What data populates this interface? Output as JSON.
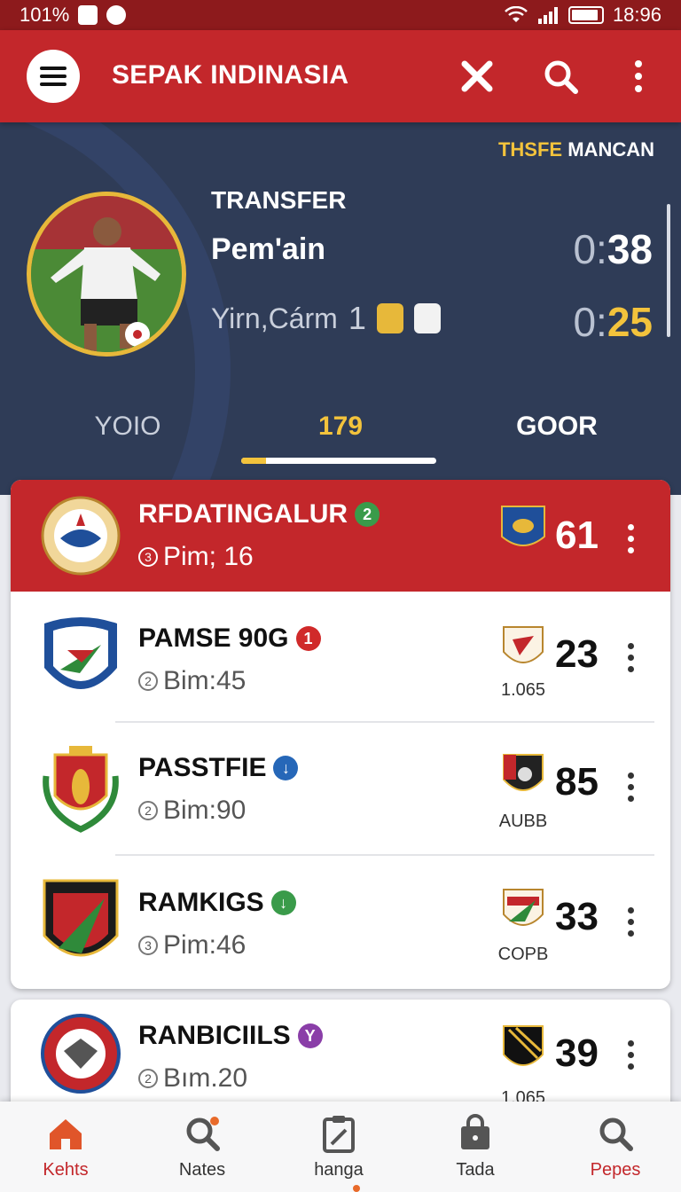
{
  "status_bar": {
    "battery_text": "101%",
    "time": "18:96"
  },
  "app_bar": {
    "title": "SEPAK INDINASIA",
    "icons": [
      "menu-icon",
      "close-icon",
      "search-icon",
      "more-vert-icon"
    ]
  },
  "hero": {
    "tag_highlight": "THSFE",
    "tag_rest": "MANCAN",
    "heading": "TRANSFER",
    "subheading": "Pem'ain",
    "line3": "Yirn,Cárm",
    "line3_num": "1",
    "timer1_prefix": "0:",
    "timer1_value": "38",
    "timer2_prefix": "0:",
    "timer2_value": "25",
    "tabs": [
      {
        "label": "YOIO"
      },
      {
        "label": "179"
      },
      {
        "label": "GOOR"
      }
    ],
    "active_tab": 1
  },
  "teams": [
    {
      "name": "RFDATINGALUR",
      "pill": "2",
      "pill_color": "#3a9b4a",
      "sub_num": "3",
      "sub": "Pim; 16",
      "opp_label": "",
      "score": "61",
      "featured": true
    },
    {
      "name": "PAMSE 90G",
      "pill": "1",
      "pill_color": "#d02a2a",
      "sub_num": "2",
      "sub": "Bim:45",
      "opp_label": "1.065",
      "score": "23",
      "featured": false
    },
    {
      "name": "PASSTFIE",
      "pill": "↓",
      "pill_color": "#2667b8",
      "sub_num": "2",
      "sub": "Bim:90",
      "opp_label": "AUBB",
      "score": "85",
      "featured": false
    },
    {
      "name": "RAMKIGS",
      "pill": "↓",
      "pill_color": "#3a9b4a",
      "sub_num": "3",
      "sub": "Pim:46",
      "opp_label": "COPB",
      "score": "33",
      "featured": false
    },
    {
      "name": "RANBICIILS",
      "pill": "Y",
      "pill_color": "#8a3ea8",
      "sub_num": "2",
      "sub": "Bım.20",
      "opp_label": "1.065",
      "score": "39",
      "featured": false
    }
  ],
  "bottom_nav": [
    {
      "label": "Kehts",
      "icon": "home-icon"
    },
    {
      "label": "Nates",
      "icon": "search-notify-icon"
    },
    {
      "label": "hanga",
      "icon": "clipboard-icon"
    },
    {
      "label": "Tada",
      "icon": "bag-icon"
    },
    {
      "label": "Pepes",
      "icon": "search-icon"
    }
  ],
  "colors": {
    "primary": "#c3272b",
    "hero_bg": "#2f3c57",
    "accent": "#f3c33c"
  }
}
